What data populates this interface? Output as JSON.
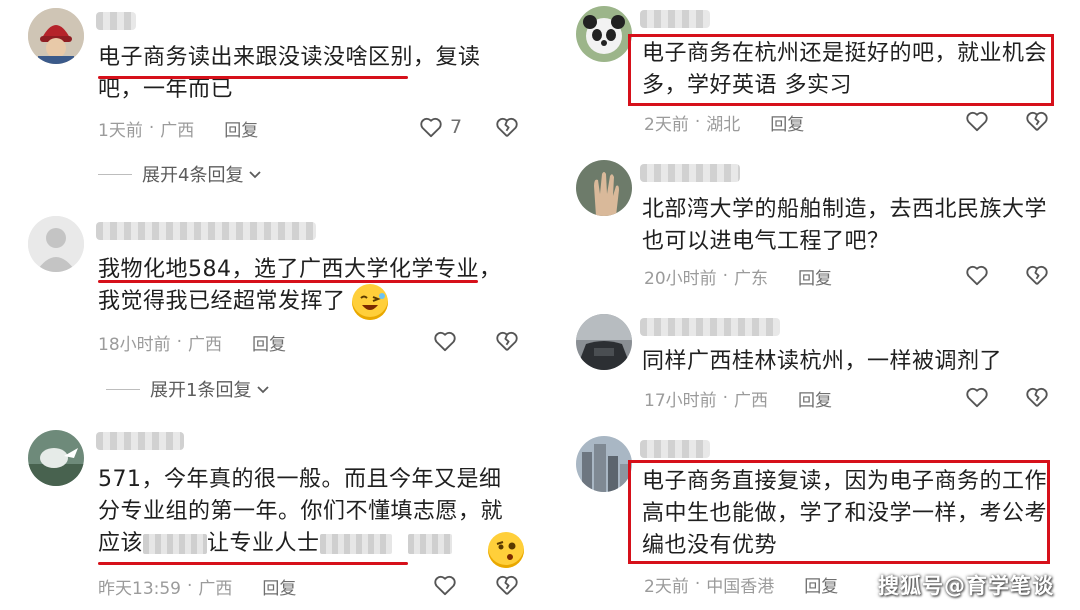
{
  "comments_left": [
    {
      "text_lines": [
        "电子商务读出来跟没读没啥区别，复读",
        "吧，一年而已"
      ],
      "time": "1天前",
      "location": "广西",
      "reply_label": "回复",
      "likes": "7",
      "expand_label": "展开4条回复"
    },
    {
      "text_lines": [
        "我物化地584，选了广西大学化学专业，",
        "我觉得我已经超常发挥了"
      ],
      "time": "18小时前",
      "location": "广西",
      "reply_label": "回复",
      "expand_label": "展开1条回复"
    },
    {
      "text_lines": [
        "571，今年真的很一般。而且今年又是细",
        "分专业组的第一年。你们不懂填志愿，就"
      ],
      "line3_start": "应该",
      "line3_mid": "让专业人士",
      "time": "昨天13:59",
      "location": "广西",
      "reply_label": "回复"
    }
  ],
  "comments_right": [
    {
      "text_lines": [
        "电子商务在杭州还是挺好的吧，就业机会",
        "多，学好英语 多实习"
      ],
      "time": "2天前",
      "location": "湖北",
      "reply_label": "回复"
    },
    {
      "text_lines": [
        "北部湾大学的船舶制造，去西北民族大学",
        "也可以进电气工程了吧？"
      ],
      "time": "20小时前",
      "location": "广东",
      "reply_label": "回复"
    },
    {
      "text_lines": [
        "同样广西桂林读杭州，一样被调剂了"
      ],
      "time": "17小时前",
      "location": "广西",
      "reply_label": "回复"
    },
    {
      "text_lines": [
        "电子商务直接复读，因为电子商务的工作",
        "高中生也能做，学了和没学一样，考公考",
        "编也没有优势"
      ],
      "time": "2天前",
      "location": "中国香港",
      "reply_label": "回复"
    }
  ],
  "meta_separator": "·",
  "watermark": "搜狐号@育学笔谈",
  "colors": {
    "highlight": "#d6101a",
    "meta": "#9b9b9b",
    "text": "#1f1f1f"
  }
}
